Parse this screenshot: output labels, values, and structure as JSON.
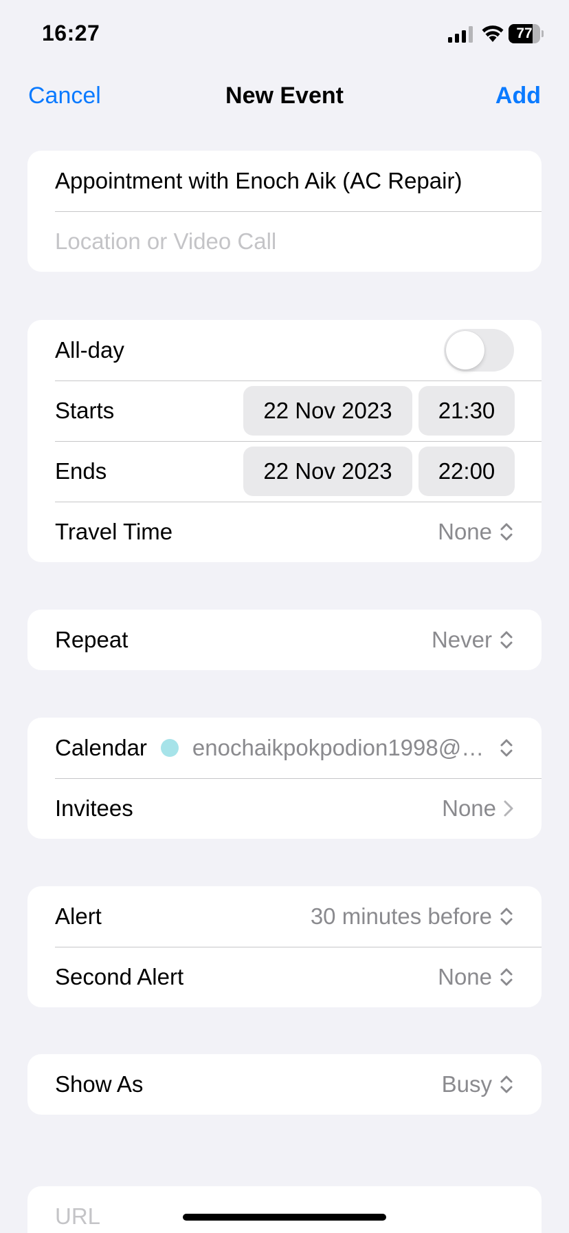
{
  "status": {
    "time": "16:27",
    "battery": "77",
    "battery_level": 0.77
  },
  "nav": {
    "cancel": "Cancel",
    "title": "New Event",
    "add": "Add"
  },
  "event": {
    "title": "Appointment with Enoch Aik (AC Repair)",
    "location_placeholder": "Location or Video Call"
  },
  "timing": {
    "allday_label": "All-day",
    "allday_on": false,
    "starts_label": "Starts",
    "starts_date": "22 Nov 2023",
    "starts_time": "21:30",
    "ends_label": "Ends",
    "ends_date": "22 Nov 2023",
    "ends_time": "22:00",
    "travel_label": "Travel Time",
    "travel_value": "None"
  },
  "repeat": {
    "label": "Repeat",
    "value": "Never"
  },
  "calendar": {
    "label": "Calendar",
    "name": "enochaikpokpodion1998@…",
    "color": "#a6e3e9",
    "invitees_label": "Invitees",
    "invitees_value": "None"
  },
  "alerts": {
    "alert_label": "Alert",
    "alert_value": "30 minutes before",
    "second_label": "Second Alert",
    "second_value": "None"
  },
  "showas": {
    "label": "Show As",
    "value": "Busy"
  },
  "url": {
    "placeholder": "URL"
  },
  "colors": {
    "accent": "#0a7aff",
    "background": "#f2f2f7",
    "secondary_text": "#8a8a8e"
  },
  "icons": [
    "signal-icon",
    "wifi-icon",
    "battery-icon",
    "updown-chevron-icon",
    "chevron-right-icon"
  ]
}
